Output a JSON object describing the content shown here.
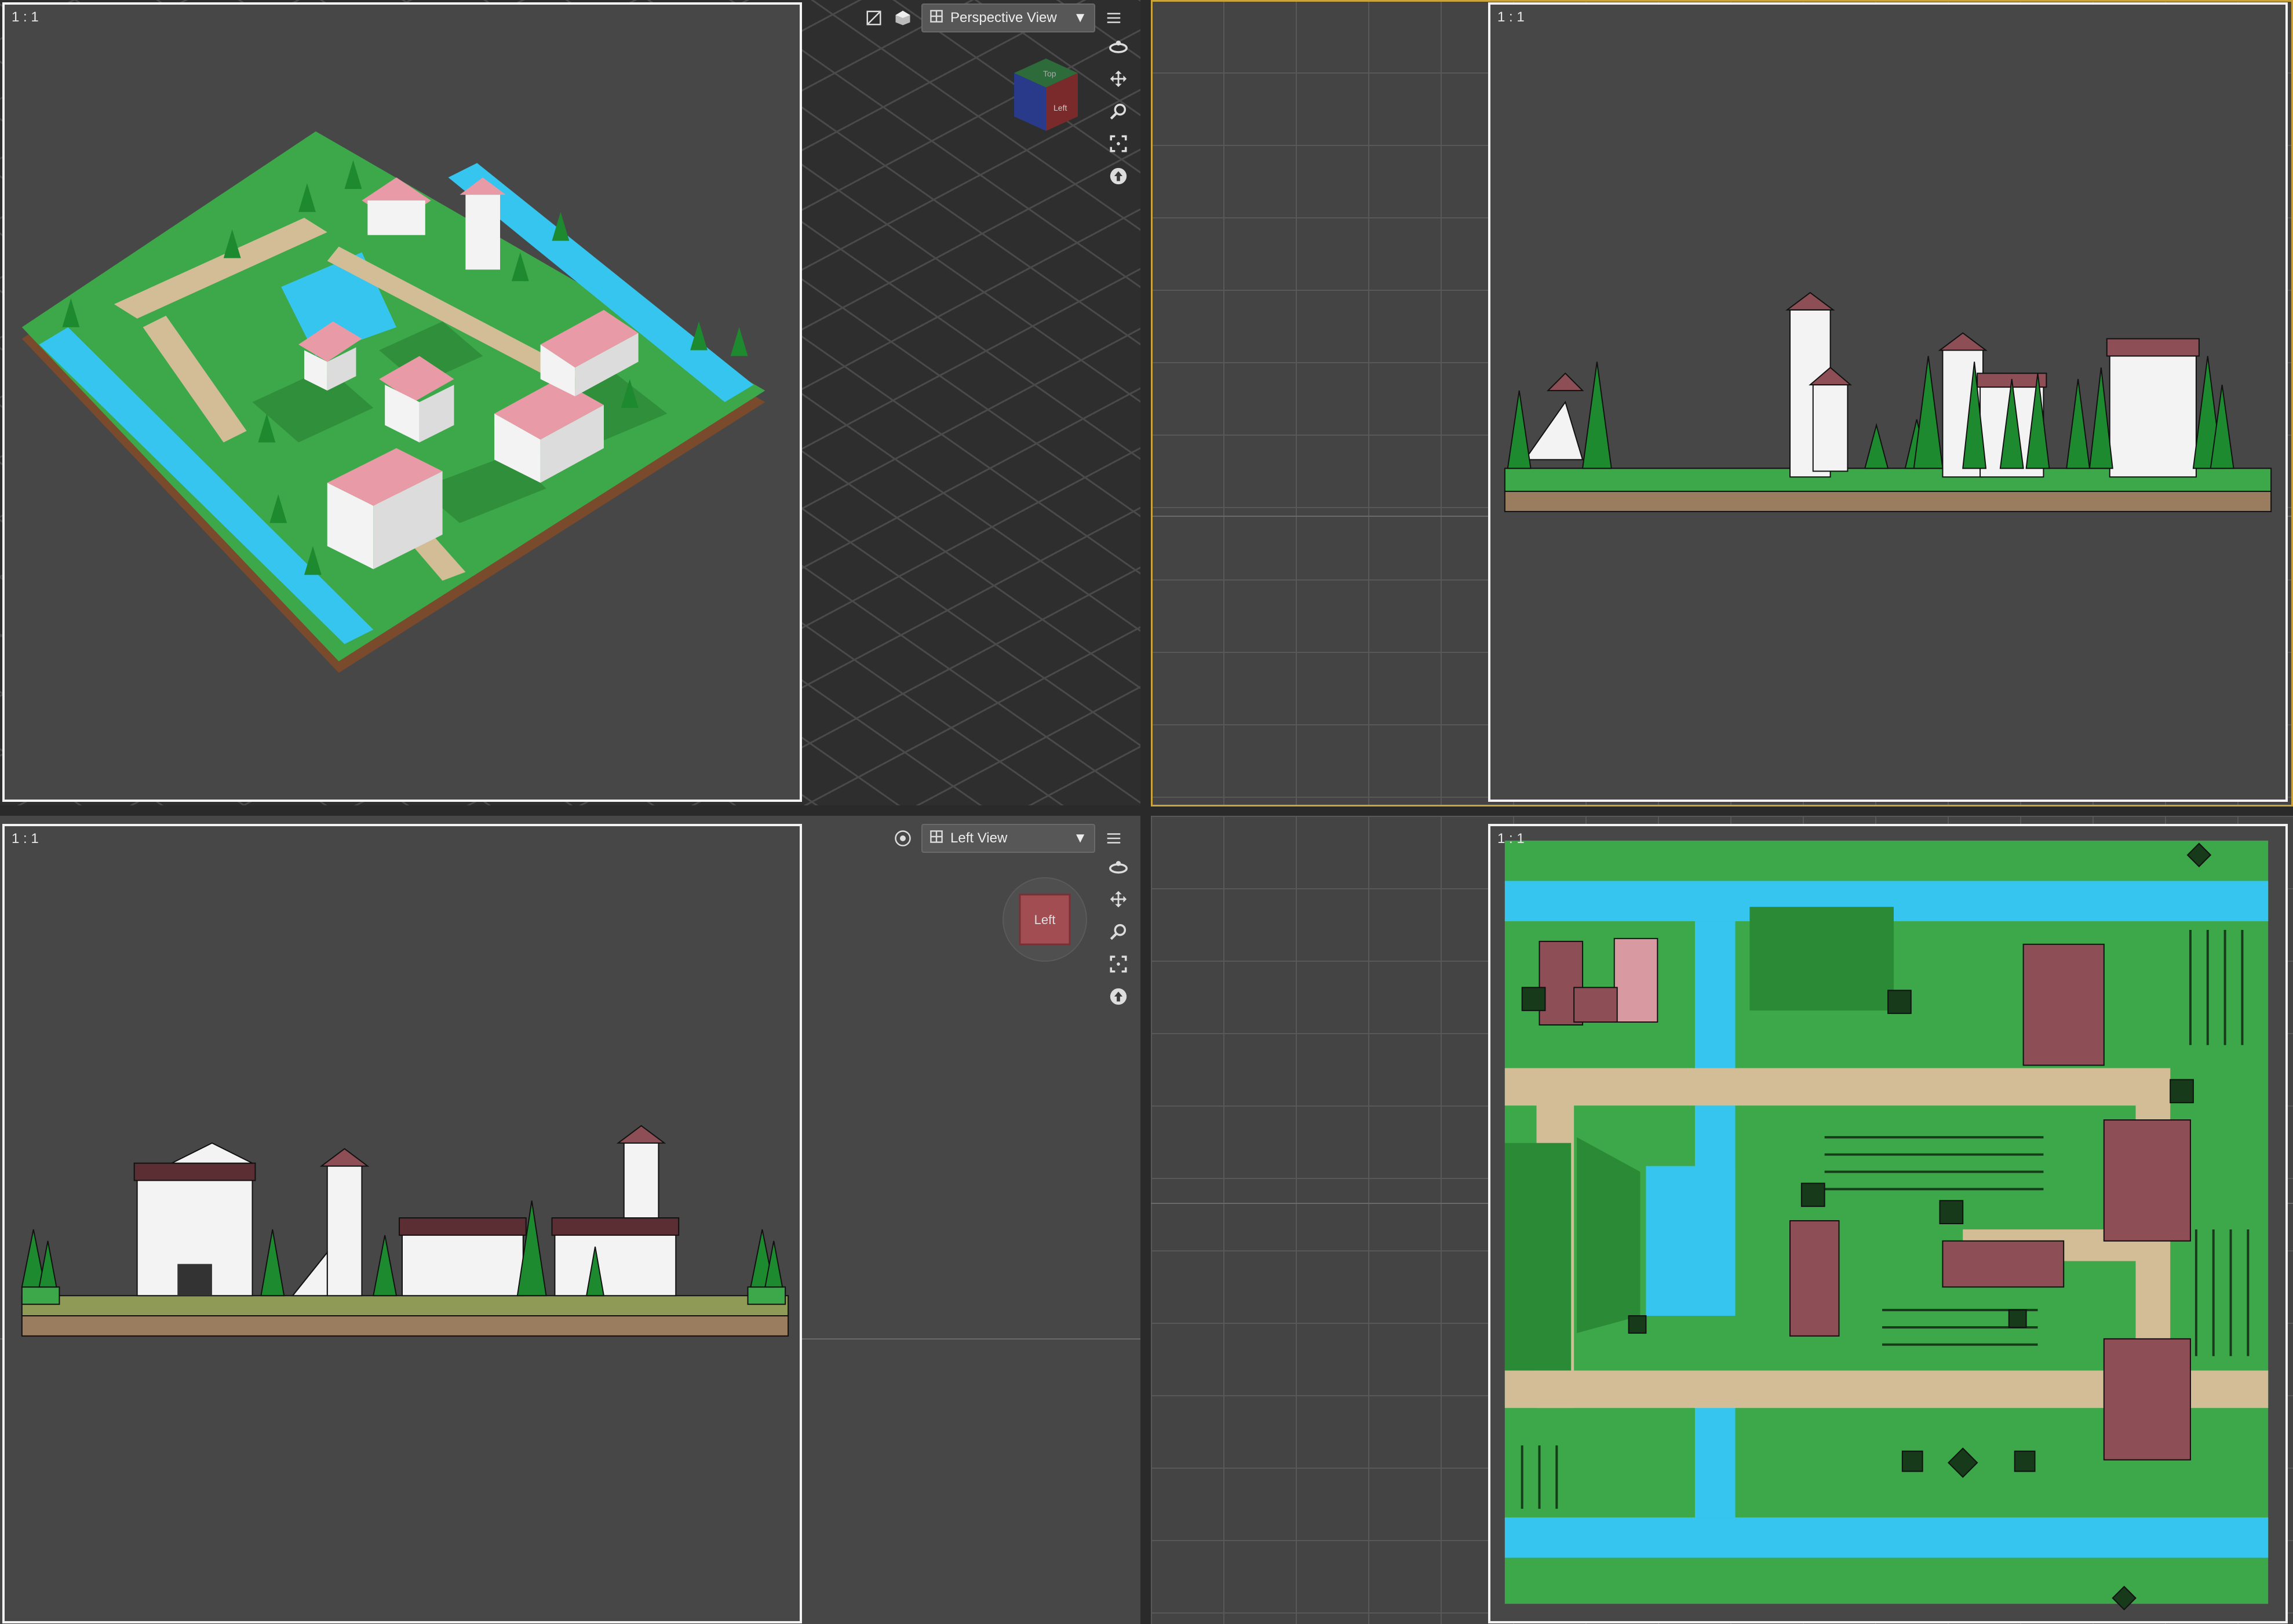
{
  "viewports": {
    "perspective": {
      "ratio": "1 : 1",
      "view_label": "Perspective View",
      "cube_faces": [
        "Top",
        "Left"
      ]
    },
    "top_right": {
      "ratio": "1 : 1"
    },
    "left": {
      "ratio": "1 : 1",
      "view_label": "Left View",
      "gizmo_label": "Left"
    },
    "bottom_right": {
      "ratio": "1 : 1"
    }
  },
  "toolbar_icons": [
    "render-region-icon",
    "display-mode-icon",
    "camera-icon",
    "dropdown-arrow-icon",
    "viewport-menu-icon"
  ],
  "nav_tools": [
    "orbit-icon",
    "pan-icon",
    "zoom-icon",
    "frame-icon",
    "reset-view-icon"
  ],
  "colors": {
    "accent_active": "#c9a43a",
    "grass": "#3da84a",
    "water": "#35c5ee",
    "path": "#d3bd96",
    "roof": "#8e4e55",
    "wall": "#f3f3f3"
  }
}
